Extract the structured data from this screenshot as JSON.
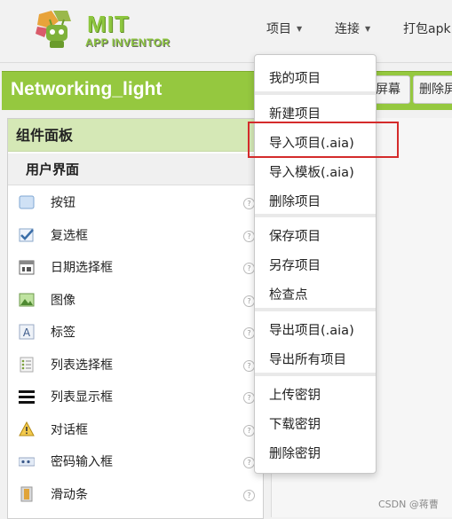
{
  "header": {
    "logo": {
      "title": "MIT",
      "subtitle": "APP INVENTOR"
    },
    "nav": [
      {
        "label": "项目",
        "has_caret": true
      },
      {
        "label": "连接",
        "has_caret": true
      },
      {
        "label": "打包apk",
        "has_caret": false
      }
    ]
  },
  "project": {
    "name": "Networking_light",
    "buttons": [
      "屏幕",
      "删除屏"
    ]
  },
  "palette": {
    "title": "组件面板",
    "category": "用户界面",
    "help_symbol": "?",
    "items": [
      {
        "label": "按钮",
        "icon": "button-icon"
      },
      {
        "label": "复选框",
        "icon": "checkbox-icon"
      },
      {
        "label": "日期选择框",
        "icon": "calendar-icon"
      },
      {
        "label": "图像",
        "icon": "image-icon"
      },
      {
        "label": "标签",
        "icon": "label-icon"
      },
      {
        "label": "列表选择框",
        "icon": "list-picker-icon"
      },
      {
        "label": "列表显示框",
        "icon": "list-view-icon"
      },
      {
        "label": "对话框",
        "icon": "warning-icon"
      },
      {
        "label": "密码输入框",
        "icon": "password-icon"
      },
      {
        "label": "滑动条",
        "icon": "slider-icon"
      }
    ]
  },
  "project_menu": {
    "items": [
      {
        "label": "我的项目"
      },
      {
        "label": "新建项目"
      },
      {
        "label": "导入项目(.aia)",
        "highlighted": true
      },
      {
        "label": "导入模板(.aia)"
      },
      {
        "label": "删除项目"
      },
      {
        "label": "保存项目"
      },
      {
        "label": "另存项目"
      },
      {
        "label": "检查点"
      },
      {
        "label": "导出项目(.aia)"
      },
      {
        "label": "导出所有项目"
      },
      {
        "label": "上传密钥"
      },
      {
        "label": "下载密钥"
      },
      {
        "label": "删除密钥"
      }
    ],
    "highlight_color": "#d42b2b"
  },
  "watermark": "CSDN @蒋曹",
  "colors": {
    "accent_green": "#95c83f",
    "palette_header": "#d5e8b6"
  }
}
